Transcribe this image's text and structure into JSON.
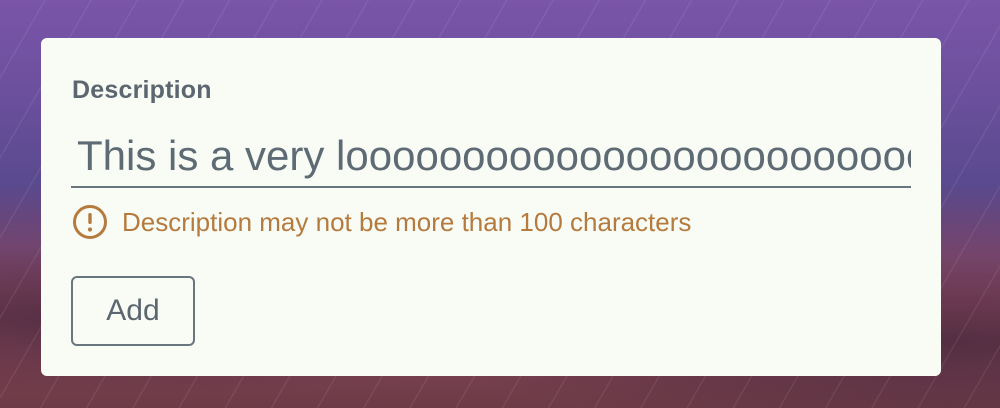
{
  "form": {
    "description_label": "Description",
    "description_value": "This is a very loooooooooooooooooooooooooooooooooooooooooooooooooooooooooooooooooooooooooooooooooooooooong description",
    "error_message": "Description may not be more than 100 characters",
    "add_label": "Add"
  },
  "colors": {
    "error": "#b57a3e",
    "text": "#5b6670",
    "card_bg": "#f8fcf5"
  },
  "icons": {
    "error": "warning-circle-icon"
  }
}
